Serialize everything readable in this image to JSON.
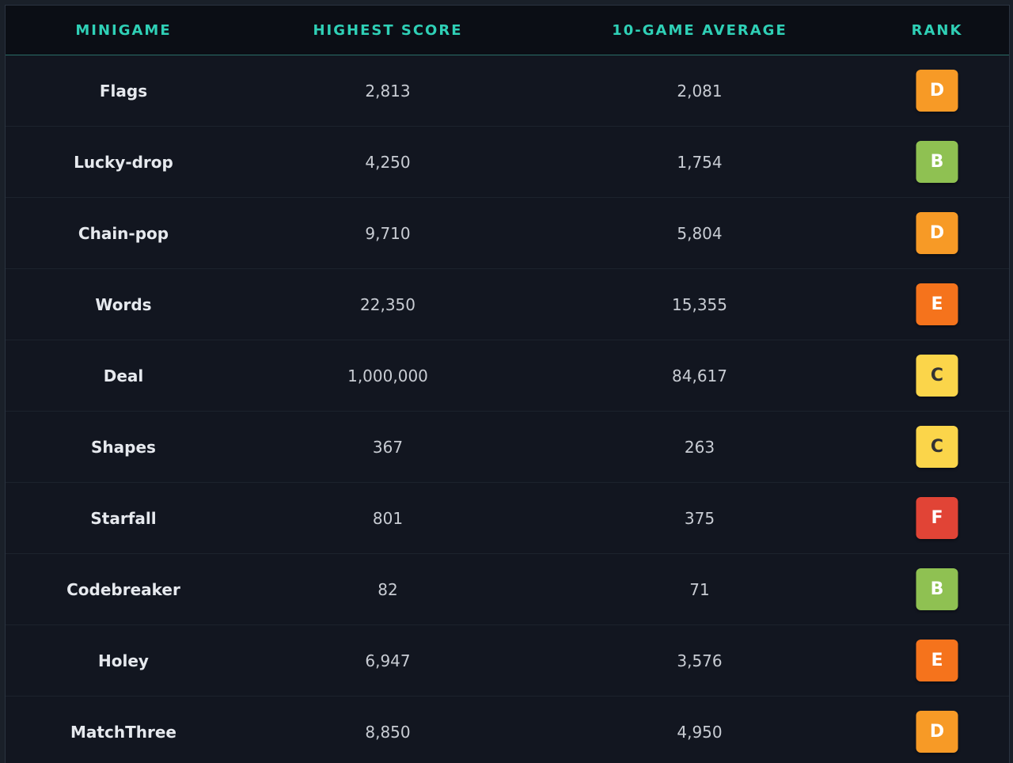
{
  "table": {
    "headers": {
      "minigame": "MINIGAME",
      "highest": "HIGHEST SCORE",
      "average": "10-GAME AVERAGE",
      "rank": "RANK"
    },
    "rows": [
      {
        "name": "Flags",
        "highest": "2,813",
        "average": "2,081",
        "rank": "D",
        "rank_bg": "#f79a26",
        "rank_fg": "#ffffff"
      },
      {
        "name": "Lucky-drop",
        "highest": "4,250",
        "average": "1,754",
        "rank": "B",
        "rank_bg": "#8fc152",
        "rank_fg": "#ffffff"
      },
      {
        "name": "Chain-pop",
        "highest": "9,710",
        "average": "5,804",
        "rank": "D",
        "rank_bg": "#f79a26",
        "rank_fg": "#ffffff"
      },
      {
        "name": "Words",
        "highest": "22,350",
        "average": "15,355",
        "rank": "E",
        "rank_bg": "#f5731c",
        "rank_fg": "#ffffff"
      },
      {
        "name": "Deal",
        "highest": "1,000,000",
        "average": "84,617",
        "rank": "C",
        "rank_bg": "#fbd54a",
        "rank_fg": "#333333"
      },
      {
        "name": "Shapes",
        "highest": "367",
        "average": "263",
        "rank": "C",
        "rank_bg": "#fbd54a",
        "rank_fg": "#333333"
      },
      {
        "name": "Starfall",
        "highest": "801",
        "average": "375",
        "rank": "F",
        "rank_bg": "#e14436",
        "rank_fg": "#ffffff"
      },
      {
        "name": "Codebreaker",
        "highest": "82",
        "average": "71",
        "rank": "B",
        "rank_bg": "#8fc152",
        "rank_fg": "#ffffff"
      },
      {
        "name": "Holey",
        "highest": "6,947",
        "average": "3,576",
        "rank": "E",
        "rank_bg": "#f5731c",
        "rank_fg": "#ffffff"
      },
      {
        "name": "MatchThree",
        "highest": "8,850",
        "average": "4,950",
        "rank": "D",
        "rank_bg": "#f79a26",
        "rank_fg": "#ffffff"
      }
    ]
  }
}
